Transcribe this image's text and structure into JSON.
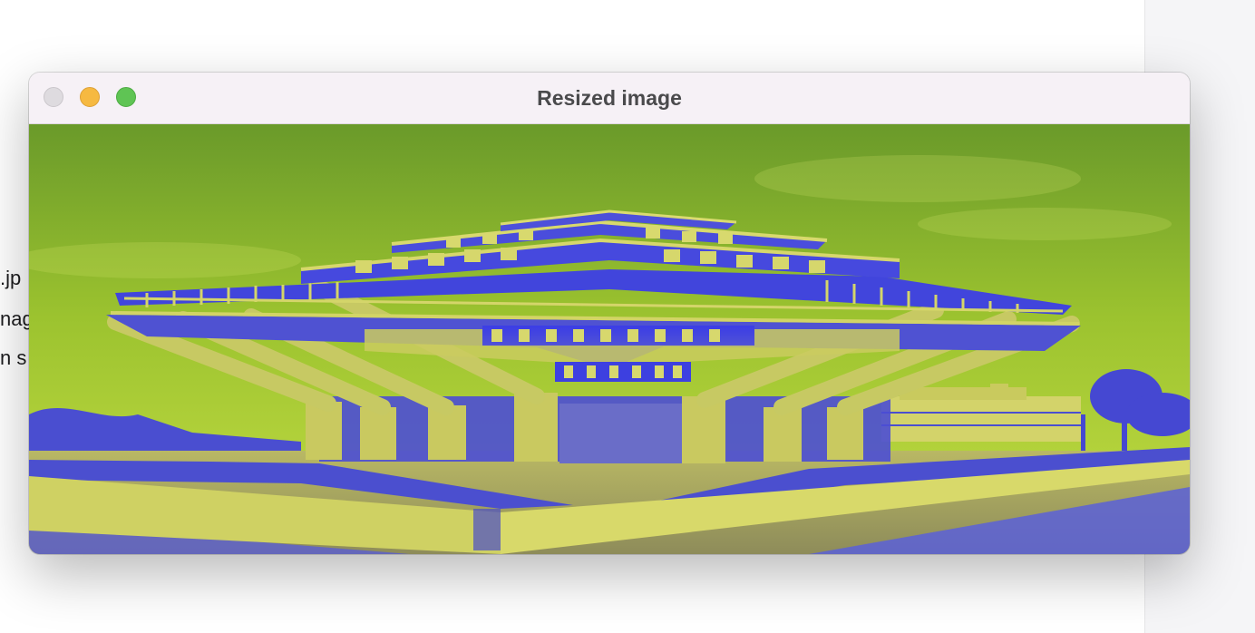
{
  "window": {
    "title": "Resized image"
  },
  "background_text": [
    ".jp",
    "nag",
    "n s"
  ],
  "image": {
    "subject": "brutalist library building under a sky, duotone yellow-green and blue",
    "colors": {
      "sky_top": "#6a9a2a",
      "sky_bottom": "#c0db3c",
      "concrete_light": "#d6d763",
      "concrete_dark": "#9a9b56",
      "glass_blue": "#3a3ce8",
      "shadow_blue": "#4848c8"
    }
  },
  "colors": {
    "titlebar": "#f6f1f6",
    "close": "#dedbdf",
    "minimize": "#f6b941",
    "maximize": "#5fc454"
  }
}
